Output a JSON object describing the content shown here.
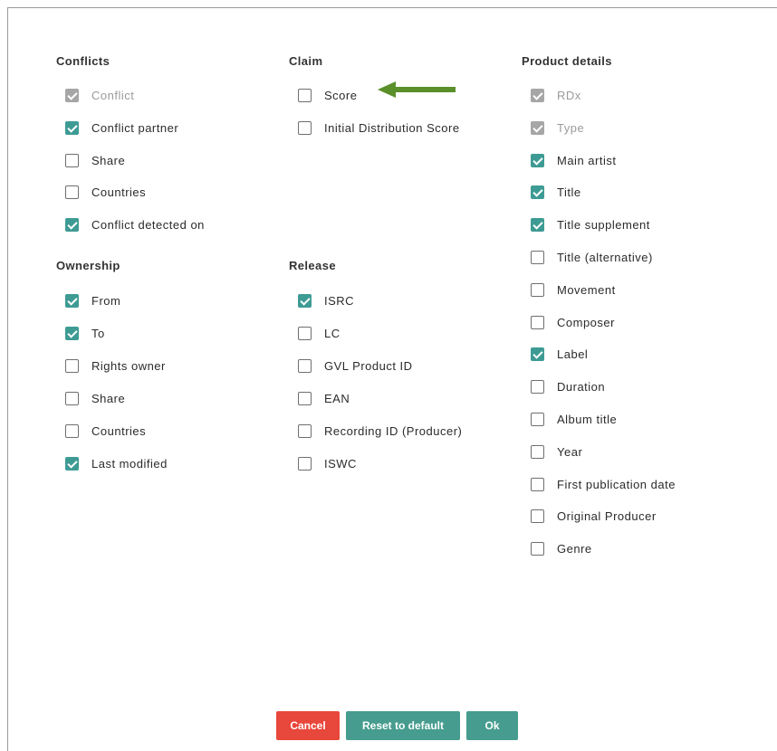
{
  "colors": {
    "checked": "#3e9b94",
    "checked_disabled": "#a6a6a6",
    "cancel_button": "#e8473b",
    "primary_button": "#469c8e",
    "arrow": "#5a8f2a"
  },
  "annotation": {
    "icon": "arrow-left-icon",
    "target": "Score"
  },
  "groups": {
    "conflicts": {
      "title": "Conflicts",
      "items": [
        {
          "label": "Conflict",
          "checked": true,
          "disabled": true
        },
        {
          "label": "Conflict partner",
          "checked": true,
          "disabled": false
        },
        {
          "label": "Share",
          "checked": false,
          "disabled": false
        },
        {
          "label": "Countries",
          "checked": false,
          "disabled": false
        },
        {
          "label": "Conflict detected on",
          "checked": true,
          "disabled": false
        }
      ]
    },
    "ownership": {
      "title": "Ownership",
      "items": [
        {
          "label": "From",
          "checked": true,
          "disabled": false
        },
        {
          "label": "To",
          "checked": true,
          "disabled": false
        },
        {
          "label": "Rights owner",
          "checked": false,
          "disabled": false
        },
        {
          "label": "Share",
          "checked": false,
          "disabled": false
        },
        {
          "label": "Countries",
          "checked": false,
          "disabled": false
        },
        {
          "label": "Last modified",
          "checked": true,
          "disabled": false
        }
      ]
    },
    "claim": {
      "title": "Claim",
      "items": [
        {
          "label": "Score",
          "checked": false,
          "disabled": false
        },
        {
          "label": "Initial Distribution Score",
          "checked": false,
          "disabled": false
        }
      ]
    },
    "release": {
      "title": "Release",
      "items": [
        {
          "label": "ISRC",
          "checked": true,
          "disabled": false
        },
        {
          "label": "LC",
          "checked": false,
          "disabled": false
        },
        {
          "label": "GVL Product ID",
          "checked": false,
          "disabled": false
        },
        {
          "label": "EAN",
          "checked": false,
          "disabled": false
        },
        {
          "label": "Recording ID (Producer)",
          "checked": false,
          "disabled": false
        },
        {
          "label": "ISWC",
          "checked": false,
          "disabled": false
        }
      ]
    },
    "product": {
      "title": "Product details",
      "items": [
        {
          "label": "RDx",
          "checked": true,
          "disabled": true
        },
        {
          "label": "Type",
          "checked": true,
          "disabled": true
        },
        {
          "label": "Main artist",
          "checked": true,
          "disabled": false
        },
        {
          "label": "Title",
          "checked": true,
          "disabled": false
        },
        {
          "label": "Title supplement",
          "checked": true,
          "disabled": false
        },
        {
          "label": "Title (alternative)",
          "checked": false,
          "disabled": false
        },
        {
          "label": "Movement",
          "checked": false,
          "disabled": false
        },
        {
          "label": "Composer",
          "checked": false,
          "disabled": false
        },
        {
          "label": "Label",
          "checked": true,
          "disabled": false
        },
        {
          "label": "Duration",
          "checked": false,
          "disabled": false
        },
        {
          "label": "Album title",
          "checked": false,
          "disabled": false
        },
        {
          "label": "Year",
          "checked": false,
          "disabled": false
        },
        {
          "label": "First publication date",
          "checked": false,
          "disabled": false
        },
        {
          "label": "Original Producer",
          "checked": false,
          "disabled": false
        },
        {
          "label": "Genre",
          "checked": false,
          "disabled": false
        }
      ]
    }
  },
  "buttons": {
    "cancel_label": "Cancel",
    "reset_label": "Reset to default",
    "ok_label": "Ok"
  }
}
